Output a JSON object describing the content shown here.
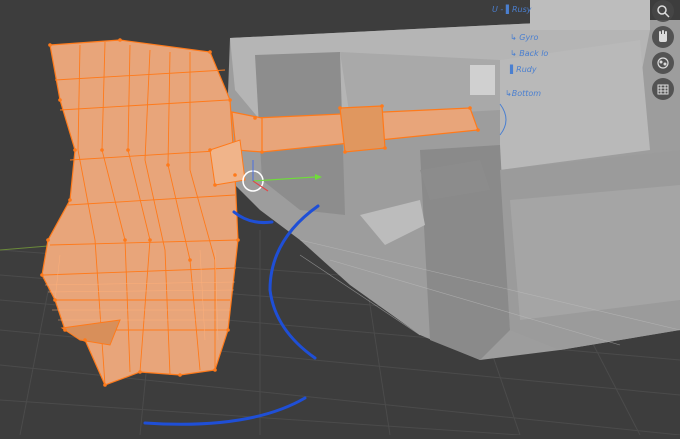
{
  "viewport": {
    "mode": "edit-mode",
    "selected_object": "mantlet-and-gun-barrel"
  },
  "nav_gizmo": {
    "buttons": [
      {
        "name": "zoom-icon",
        "glyph": "⚲"
      },
      {
        "name": "hand-icon",
        "glyph": "✋"
      },
      {
        "name": "camera-icon",
        "glyph": "◎"
      },
      {
        "name": "grid-icon",
        "glyph": "▦"
      }
    ]
  },
  "annotations": {
    "line1": "U - ▌Rusy",
    "line2": "↳ Gyro",
    "line3": "↳ Back lo",
    "line4": "▌Rudy",
    "line5": "↳Bottom"
  },
  "colors": {
    "background": "#3d3d3d",
    "grid": "#555555",
    "selected_face": "#e8a57a",
    "selected_edge": "#ff7a1a",
    "hull": "#a7a7a7",
    "sketch_blue": "#1f4fd6"
  }
}
